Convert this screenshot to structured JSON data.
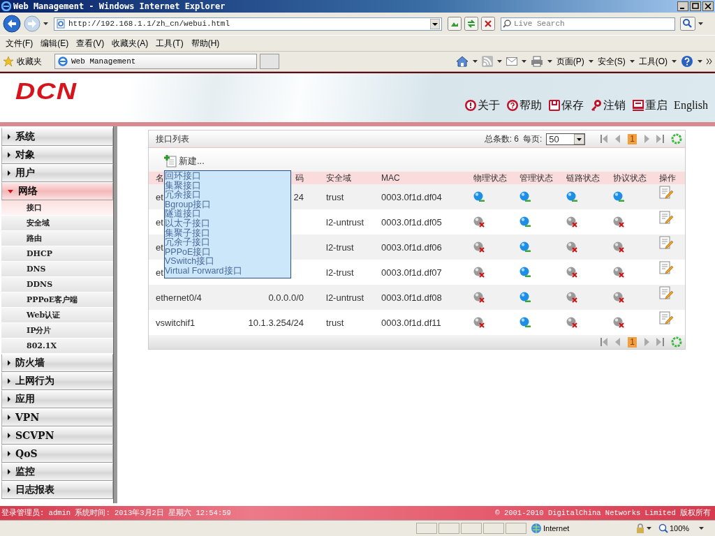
{
  "browser": {
    "title": "Web Management - Windows Internet Explorer",
    "address": "http://192.168.1.1/zh_cn/webui.html",
    "search_placeholder": "Live Search",
    "menu": [
      "文件(F)",
      "编辑(E)",
      "查看(V)",
      "收藏夹(A)",
      "工具(T)",
      "帮助(H)"
    ],
    "favorites": "收藏夹",
    "tab": "Web Management",
    "commands": [
      "页面(P)",
      "安全(S)",
      "工具(O)"
    ],
    "status_zone": "Internet",
    "zoom": "100%"
  },
  "header": {
    "logo": "DCN",
    "links": [
      "关于",
      "帮助",
      "保存",
      "注销",
      "重启"
    ],
    "language": "English"
  },
  "sidebar": {
    "items": [
      {
        "label": "系统",
        "expanded": false
      },
      {
        "label": "对象",
        "expanded": false
      },
      {
        "label": "用户",
        "expanded": false
      },
      {
        "label": "网络",
        "expanded": true,
        "children": [
          {
            "label": "接口",
            "selected": true
          },
          {
            "label": "安全域",
            "selected": false
          },
          {
            "label": "路由",
            "selected": false
          },
          {
            "label": "DHCP",
            "selected": false
          },
          {
            "label": "DNS",
            "selected": false
          },
          {
            "label": "DDNS",
            "selected": false
          },
          {
            "label": "PPPoE客户端",
            "selected": false
          },
          {
            "label": "Web认证",
            "selected": false
          },
          {
            "label": "IP分片",
            "selected": false
          },
          {
            "label": "802.1X",
            "selected": false
          }
        ]
      },
      {
        "label": "防火墙",
        "expanded": false
      },
      {
        "label": "上网行为",
        "expanded": false
      },
      {
        "label": "应用",
        "expanded": false
      },
      {
        "label": "VPN",
        "expanded": false
      },
      {
        "label": "SCVPN",
        "expanded": false
      },
      {
        "label": "QoS",
        "expanded": false
      },
      {
        "label": "监控",
        "expanded": false
      },
      {
        "label": "日志报表",
        "expanded": false
      }
    ]
  },
  "panel": {
    "title": "接口列表",
    "total": "总条数: 6",
    "per_page_label": "每页:",
    "per_page": "50",
    "page": "1",
    "bottom_page": "1",
    "new_button": "新建...",
    "new_menu": [
      "回环接口",
      "集聚接口",
      "冗余接口",
      "Bgroup接口",
      "隧道接口",
      "以太子接口",
      "集聚子接口",
      "冗余子接口",
      "PPPoE接口",
      "VSwitch接口",
      "Virtual Forward接口"
    ],
    "columns": [
      "名",
      "码",
      "安全域",
      "MAC",
      "物理状态",
      "管理状态",
      "链路状态",
      "协议状态",
      "操作"
    ],
    "rows": [
      {
        "name": "et",
        "ip": "24",
        "zone": "trust",
        "mac": "0003.0f1d.df04",
        "physical": true,
        "admin": true,
        "link": true,
        "protocol": true
      },
      {
        "name": "et",
        "zone": "l2-untrust",
        "mac": "0003.0f1d.df05",
        "physical": false,
        "admin": true,
        "link": false,
        "protocol": false
      },
      {
        "name": "et",
        "zone": "l2-trust",
        "mac": "0003.0f1d.df06",
        "physical": false,
        "admin": true,
        "link": false,
        "protocol": false
      },
      {
        "name": "et",
        "zone": "l2-trust",
        "mac": "0003.0f1d.df07",
        "physical": false,
        "admin": true,
        "link": false,
        "protocol": false
      },
      {
        "name": "ethernet0/4",
        "ip": "0.0.0.0/0",
        "zone": "l2-untrust",
        "mac": "0003.0f1d.df08",
        "physical": false,
        "admin": true,
        "link": false,
        "protocol": false
      },
      {
        "name": "vswitchif1",
        "ip": "10.1.3.254/24",
        "zone": "trust",
        "mac": "0003.0f1d.df11",
        "physical": false,
        "admin": true,
        "link": false,
        "protocol": false
      }
    ]
  },
  "footer": {
    "login": "登录管理员: admin 系统时间: 2013年3月2日 星期六 12:54:59",
    "copyright": "© 2001-2010 DigitalChina Networks Limited 版权所有"
  }
}
